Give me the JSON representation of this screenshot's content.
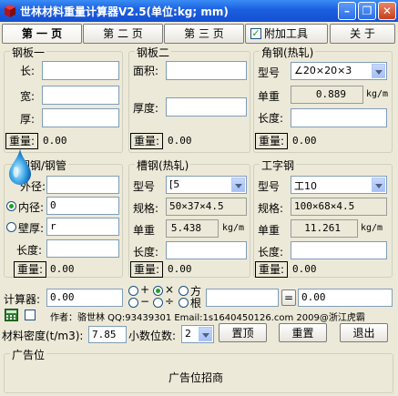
{
  "window": {
    "title": "世林材料重量计算器V2.5(单位:kg; mm)",
    "minimize_glyph": "–",
    "restore_glyph": "❐",
    "close_glyph": "✕"
  },
  "tabs": [
    {
      "label": "第 一 页"
    },
    {
      "label": "第 二 页"
    },
    {
      "label": "第 三 页"
    }
  ],
  "extra_tools": {
    "label": "附加工具",
    "checked": true,
    "check_glyph": "✓"
  },
  "about_button": "关 于",
  "steel_plate_1": {
    "title": "钢板一",
    "length_label": "长:",
    "length_value": "",
    "width_label": "宽:",
    "width_value": "",
    "thick_label": "厚:",
    "thick_value": "",
    "weight_button": "重量:",
    "weight_result": "0.00"
  },
  "steel_plate_2": {
    "title": "钢板二",
    "area_label": "面积:",
    "area_value": "",
    "thick_label": "厚度:",
    "thick_value": "",
    "weight_button": "重量:",
    "weight_result": "0.00"
  },
  "angle_steel": {
    "title": "角钢(热轧)",
    "model_label": "型号",
    "model_value": "∠20×20×3",
    "unit_weight_label": "单重",
    "unit_weight_value": "0.889",
    "unit": "kg/m",
    "length_label": "长度:",
    "length_value": "",
    "weight_button": "重量:",
    "weight_result": "0.00"
  },
  "round_tube": {
    "title": "圆钢/钢管",
    "outer_label": "外径:",
    "outer_value": "",
    "inner_label": "内径:",
    "inner_value": "0",
    "inner_selected": true,
    "wall_label": "壁厚:",
    "wall_value": "r",
    "wall_selected": false,
    "length_label": "长度:",
    "length_value": "",
    "weight_button": "重量:",
    "weight_result": "0.00"
  },
  "channel_steel": {
    "title": "槽钢(热轧)",
    "model_label": "型号",
    "model_value": "[5",
    "spec_label": "规格:",
    "spec_value": "50×37×4.5",
    "unit_weight_label": "单重",
    "unit_weight_value": "5.438",
    "unit": "kg/m",
    "length_label": "长度:",
    "length_value": "",
    "weight_button": "重量:",
    "weight_result": "0.00"
  },
  "i_beam": {
    "title": "工字钢",
    "model_label": "型号",
    "model_value": "工10",
    "spec_label": "规格:",
    "spec_value": "100×68×4.5",
    "unit_weight_label": "单重",
    "unit_weight_value": "11.261",
    "unit": "kg/m",
    "length_label": "长度:",
    "length_value": "",
    "weight_button": "重量:",
    "weight_result": "0.00"
  },
  "calculator": {
    "label": "计算器:",
    "operand1": "0.00",
    "ops": [
      {
        "symbol": "+",
        "selected": false
      },
      {
        "symbol": "×",
        "selected": true
      },
      {
        "symbol": "方",
        "selected": false
      },
      {
        "symbol": "−",
        "selected": false
      },
      {
        "symbol": "÷",
        "selected": false
      },
      {
        "symbol": "根",
        "selected": false
      }
    ],
    "operand2": "",
    "equals_button": "=",
    "result": "0.00"
  },
  "footer": {
    "author_line": "作者：骆世林 QQ:93439301 Email:1s1640450126.com  2009@浙江虎霸"
  },
  "settings": {
    "density_label": "材料密度(t/m3):",
    "density_value": "7.85",
    "decimals_label": "小数位数:",
    "decimals_value": "2",
    "top_button": "置顶",
    "reset_button": "重置",
    "exit_button": "退出"
  },
  "ad": {
    "title": "广告位",
    "text": "广告位招商"
  }
}
